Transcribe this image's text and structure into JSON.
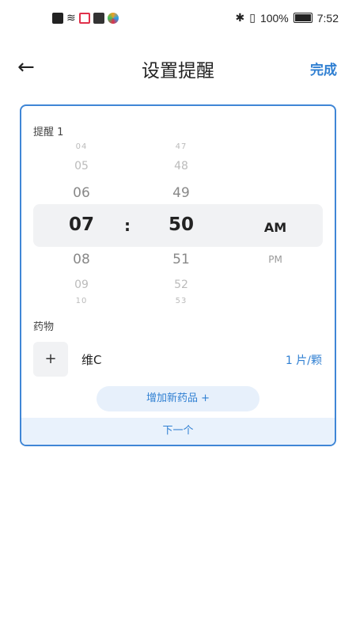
{
  "status_bar": {
    "left_icons": [
      {
        "name": "alert-icon",
        "color": "#222222"
      },
      {
        "name": "wifi-icon",
        "color": "#222222"
      },
      {
        "name": "app-red-icon",
        "color": "#e0304a"
      },
      {
        "name": "mail-icon",
        "color": "#333333"
      },
      {
        "name": "colorful-app-icon",
        "color": "#f0a020"
      }
    ],
    "battery_percent": "100%",
    "time": "7:52"
  },
  "header": {
    "back_glyph": "←",
    "title": "设置提醒",
    "done_label": "完成"
  },
  "card": {
    "reminder_label": "提醒 1",
    "picker": {
      "hours": [
        "04",
        "05",
        "06",
        "07",
        "08",
        "09",
        "10"
      ],
      "minutes": [
        "47",
        "48",
        "49",
        "50",
        "51",
        "52",
        "53"
      ],
      "colon": ":",
      "ampm_selected": "AM",
      "ampm_other": "PM"
    },
    "medicine_label": "药物",
    "add_plus": "+",
    "medicine_name": "维C",
    "medicine_dose": "1 片/颗",
    "add_medicine_label": "增加新药品 +",
    "next_label": "下一个"
  },
  "colors": {
    "accent": "#2f7fd2",
    "card_border": "#3f86d6",
    "selected_band": "#f1f2f4"
  }
}
